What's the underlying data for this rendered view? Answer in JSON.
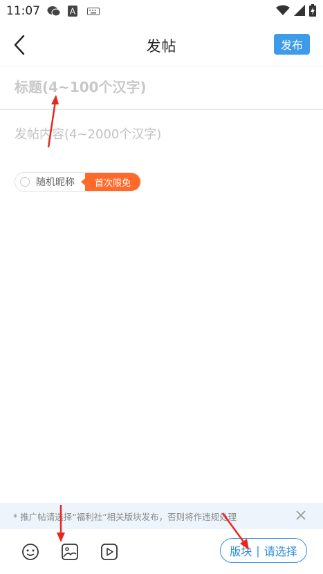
{
  "status_bar": {
    "time": "11:07"
  },
  "header": {
    "title": "发帖",
    "publish_label": "发布"
  },
  "editor": {
    "title_placeholder": "标题(4~100个汉字)",
    "content_placeholder": "发帖内容(4~2000个汉字)"
  },
  "random_nickname": {
    "label": "随机昵称",
    "badge": "首次限免"
  },
  "notice": {
    "text": "* 推广帖请选择“福利社”相关版块发布，否则将作违规处理"
  },
  "toolbar": {
    "tools": [
      "emoji-icon",
      "image-icon",
      "video-icon"
    ],
    "section_label": "版块",
    "section_value": "请选择"
  },
  "colors": {
    "accent": "#3d9be9",
    "badge": "#ff6a2a",
    "annotation": "#e8261f"
  }
}
